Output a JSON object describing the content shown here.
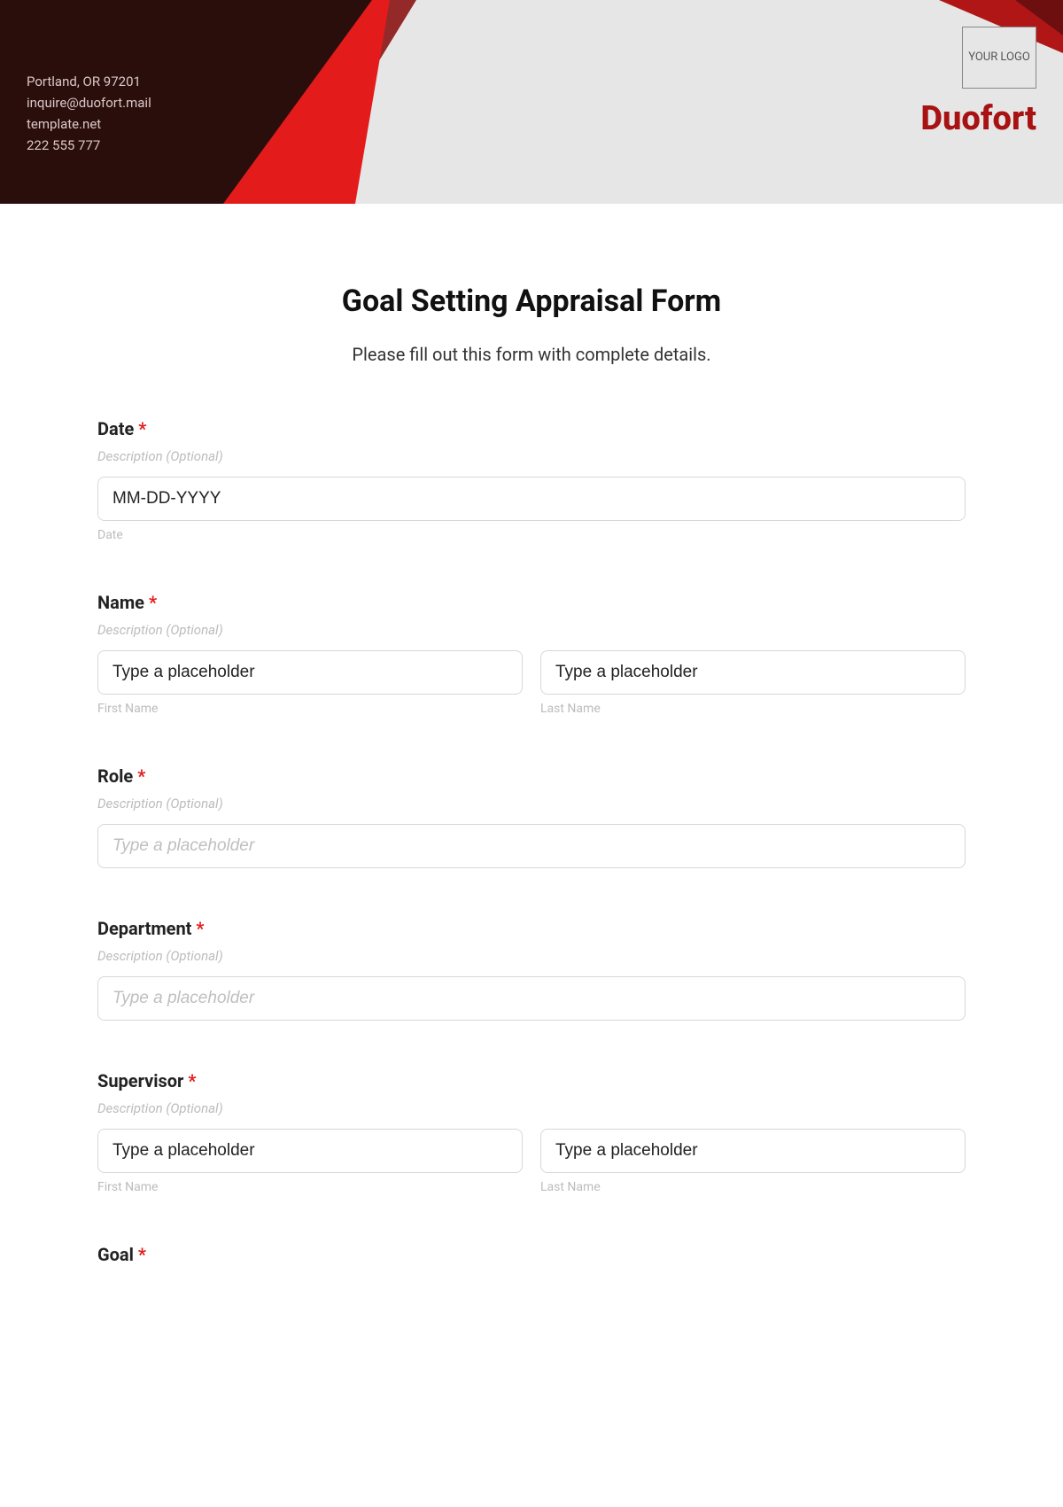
{
  "header": {
    "contact_line1": "Portland, OR 97201",
    "contact_line2": "inquire@duofort.mail",
    "contact_line3": "template.net",
    "contact_line4": "222 555 777",
    "logo_text": "YOUR LOGO",
    "brand": "Duofort"
  },
  "form": {
    "title": "Goal Setting Appraisal Form",
    "subtitle": "Please fill out this form with complete details.",
    "desc_placeholder": "Description (Optional)",
    "type_placeholder": "Type a placeholder",
    "date": {
      "label": "Date",
      "req": "*",
      "placeholder": "MM-DD-YYYY",
      "sublabel": "Date"
    },
    "name": {
      "label": "Name",
      "req": "*",
      "first_sublabel": "First Name",
      "last_sublabel": "Last Name"
    },
    "role": {
      "label": "Role",
      "req": "*"
    },
    "department": {
      "label": "Department",
      "req": "*"
    },
    "supervisor": {
      "label": "Supervisor",
      "req": "*",
      "first_sublabel": "First Name",
      "last_sublabel": "Last Name"
    },
    "goal": {
      "label": "Goal",
      "req": "*"
    }
  }
}
